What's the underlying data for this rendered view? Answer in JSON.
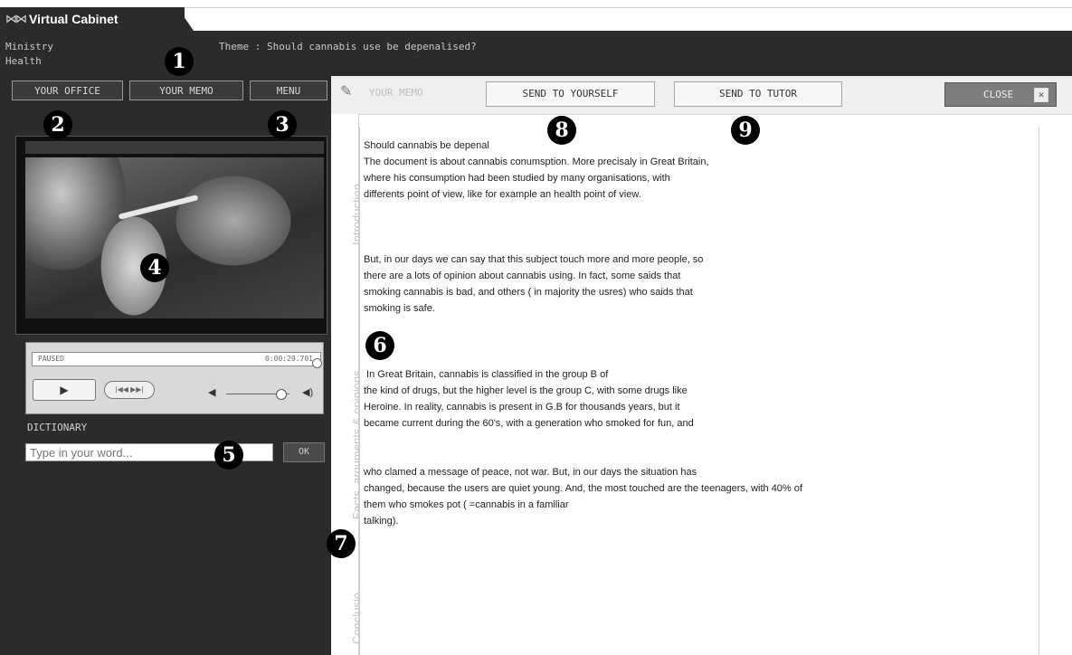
{
  "app": {
    "title": "Virtual Cabinet",
    "logo_icon": "union-flag-icon"
  },
  "header": {
    "ministry_line1": "Ministry",
    "ministry_line2": "Health",
    "theme": "Theme : Should cannabis use be depenalised?"
  },
  "nav": {
    "your_office": "YOUR OFFICE",
    "your_memo": "YOUR MEMO",
    "menu": "MENU"
  },
  "video": {
    "status": "PAUSED",
    "time": "0:00:29.701",
    "play_symbol": "▶",
    "skip_label": "|◀◀ ▶▶|",
    "volume_low_icon": "◀",
    "volume_high_icon": "◀)"
  },
  "dictionary": {
    "label": "DICTIONARY",
    "placeholder": "Type in your word...",
    "ok": "OK"
  },
  "memo": {
    "label": "YOUR MEMO",
    "send_to_yourself": "SEND TO YOURSELF",
    "send_to_tutor": "SEND TO TUTOR",
    "close": "CLOSE",
    "close_icon": "✕"
  },
  "side_tabs": {
    "introduction": "Introduction",
    "facts": "Facts, arguments & opinions",
    "conclusion": "Conclusio"
  },
  "document": {
    "p1": "Should cannabis be depenal\nThe document is about cannabis conumsption. More precisaly in Great Britain,\nwhere his consumption had been studied by many organisations, with\ndifferents point of view, like for example an health point of view.",
    "p2": "But, in our days we can say that this subject touch more and more people, so\nthere are a lots of opinion about cannabis using. In fact, some saids that\nsmoking cannabis is bad, and others ( in majority the usres) who saids that\nsmoking is safe.",
    "p3": " In Great Britain, cannabis is classified in the group B of\nthe kind of drugs, but the higher level is the group C, with some drugs like\nHeroine. In reality, cannabis is present in G.B for thousands years, but it\nbecame current during the 60's, with a generation who smoked for fun, and",
    "p4": "who clamed a message of peace, not war. But, in our days the situation has\nchanged, because the users are quiet young. And, the most touched are the teenagers, with 40% of\nthem who smokes pot ( =cannabis in a familiar\ntalking)."
  },
  "callouts": [
    "1",
    "2",
    "3",
    "4",
    "5",
    "6",
    "7",
    "8",
    "9"
  ]
}
